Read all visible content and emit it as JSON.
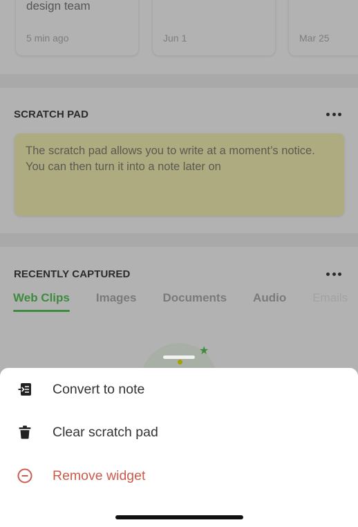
{
  "notes_carousel": {
    "cards": [
      {
        "text": "design team",
        "date": "5 min ago"
      },
      {
        "text": "",
        "date": "Jun 1"
      },
      {
        "text": "",
        "date": "Mar 25"
      }
    ]
  },
  "scratch_pad": {
    "title": "SCRATCH PAD",
    "more_icon": "more-horizontal-icon",
    "text": "The scratch pad allows you to write at a moment’s notice. You can then turn it into a note later on",
    "background_color": "#afab80"
  },
  "recently_captured": {
    "title": "RECENTLY CAPTURED",
    "more_icon": "more-horizontal-icon",
    "tabs": [
      {
        "label": "Web Clips",
        "active": true
      },
      {
        "label": "Images",
        "active": false
      },
      {
        "label": "Documents",
        "active": false
      },
      {
        "label": "Audio",
        "active": false
      },
      {
        "label": "Emails",
        "active": false
      }
    ],
    "illustration_icon": "star-icon"
  },
  "action_sheet": {
    "items": [
      {
        "label": "Convert to note",
        "icon": "convert-to-note-icon"
      },
      {
        "label": "Clear scratch pad",
        "icon": "trash-icon"
      },
      {
        "label": "Remove widget",
        "icon": "remove-circle-icon",
        "color": "#cc5a4b"
      }
    ]
  },
  "colors": {
    "accent_green": "#3e8a3e",
    "destructive_red": "#cc5a4b"
  }
}
